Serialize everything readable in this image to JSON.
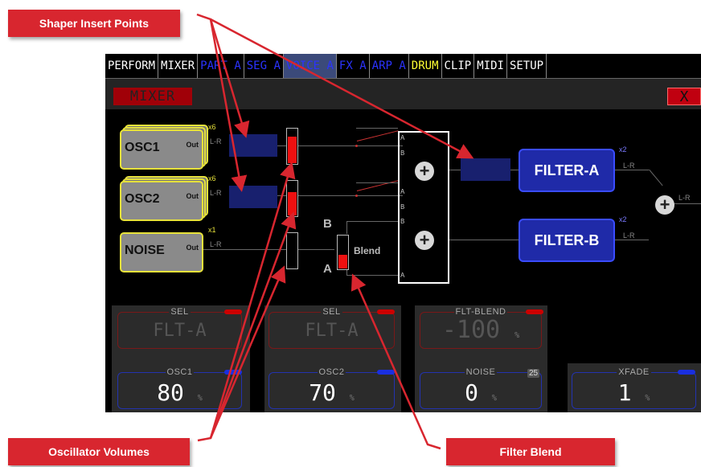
{
  "callouts": {
    "shaper": "Shaper Insert Points",
    "osc_volumes": "Oscillator Volumes",
    "filter_blend": "Filter Blend"
  },
  "tabs": [
    {
      "label": "PERFORM",
      "color": "white"
    },
    {
      "label": "MIXER",
      "color": "white"
    },
    {
      "label": "PART A",
      "color": "blue"
    },
    {
      "label": "SEG A",
      "color": "blue"
    },
    {
      "label": "VOICE A",
      "color": "blue"
    },
    {
      "label": "FX A",
      "color": "blue"
    },
    {
      "label": "ARP A",
      "color": "blue"
    },
    {
      "label": "DRUM",
      "color": "yellow"
    },
    {
      "label": "CLIP",
      "color": "white"
    },
    {
      "label": "MIDI",
      "color": "white"
    },
    {
      "label": "SETUP",
      "color": "white"
    }
  ],
  "title": "MIXER",
  "close_label": "X",
  "sources": [
    {
      "label": "OSC1",
      "out": "Out",
      "mult": "x6",
      "lr": "L-R"
    },
    {
      "label": "OSC2",
      "out": "Out",
      "mult": "x6",
      "lr": "L-R"
    },
    {
      "label": "NOISE",
      "out": "Out",
      "mult": "x1",
      "lr": "L-R"
    }
  ],
  "filters": [
    {
      "label": "FILTER-A",
      "mult": "x2",
      "lr": "L-R"
    },
    {
      "label": "FILTER-B",
      "mult": "x2",
      "lr": "L-R"
    }
  ],
  "output_lr": "L-R",
  "volumes": {
    "osc1": 0.8,
    "osc2": 0.7,
    "noise": 0.0,
    "blend": 0.45
  },
  "blend": {
    "b": "B",
    "a": "A",
    "label": "Blend"
  },
  "ports": {
    "a": "A",
    "b": "B"
  },
  "knobs_top": [
    {
      "caption": "SEL",
      "value": "FLT-A",
      "unit": ""
    },
    {
      "caption": "SEL",
      "value": "FLT-A",
      "unit": ""
    },
    {
      "caption": "FLT-BLEND",
      "value": "-100",
      "unit": "%"
    }
  ],
  "knobs_bottom": [
    {
      "caption": "OSC1",
      "value": "80",
      "unit": "%"
    },
    {
      "caption": "OSC2",
      "value": "70",
      "unit": "%"
    },
    {
      "caption": "NOISE",
      "value": "0",
      "unit": "%",
      "badge": "25"
    },
    {
      "caption": "XFADE",
      "value": "1",
      "unit": "%"
    }
  ],
  "colors": {
    "accent_red": "#d8262f",
    "filter_blue": "#1f2aa8",
    "block_yellow": "#e7e23a"
  }
}
